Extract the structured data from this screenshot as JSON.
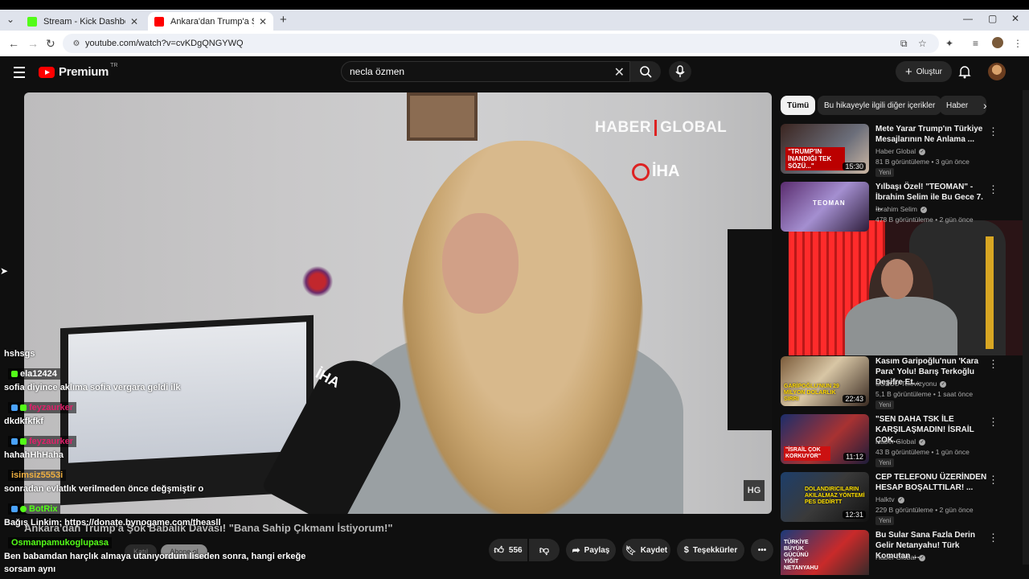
{
  "browser": {
    "tabs": [
      {
        "title": "Stream - Kick Dashboard",
        "favicon_color": "#53fc18"
      },
      {
        "title": "Ankara'dan Trump'a Şok Babal",
        "favicon_color": "#ff0000"
      }
    ],
    "url": "youtube.com/watch?v=cvKDgQNGYWQ"
  },
  "header": {
    "logo": "Premium",
    "logo_region": "TR",
    "search_value": "necla özmen",
    "create_label": "Oluştur"
  },
  "video": {
    "watermark_left": "HABER",
    "watermark_right": "GLOBAL",
    "agency": "İHA",
    "mic_label": "İHA",
    "corner_badge": "HG",
    "title": "Ankara'dan Trump'a Şok Babalık Davası! \"Bana Sahip Çıkmanı İstiyorum!\""
  },
  "chat": [
    {
      "user": "",
      "message": "hshsgs"
    },
    {
      "user": "ela12424",
      "user_color": "#ffffff",
      "message": "sofia diyince aklıma sofia vergara geldi ilk"
    },
    {
      "user": "feyzaurker",
      "user_color": "#e0206a",
      "message": "dkdkfkfkf"
    },
    {
      "user": "feyzaurker",
      "user_color": "#e0206a",
      "message": "hahahHhHaha"
    },
    {
      "user": "isimsiz5553i",
      "user_color": "#f0b040",
      "message": "sonradan evlatlık verilmeden önce değşmiştir o"
    },
    {
      "user": "BotRix",
      "user_color": "#53fc18",
      "message": "Bağış Linkim: https://donate.bynogame.com/theasll"
    },
    {
      "user": "Osmanpamukoglupasa",
      "user_color": "#53fc18",
      "message": "Ben babamdan harçlık almaya utanıyordum liseden sonra, hangi erkeğe"
    },
    {
      "user": "",
      "message": "sorsam aynı"
    }
  ],
  "ghost_buttons": {
    "join": "Katıl",
    "subscribe": "Abone ol"
  },
  "actions": {
    "likes": "556",
    "share": "Paylaş",
    "save": "Kaydet",
    "thanks": "Teşekkürler"
  },
  "chips": [
    "Tümü",
    "Bu hikayeyle ilgili diğer içerikler",
    "Haber"
  ],
  "recommendations": [
    {
      "title": "Mete Yarar Trump'ın Türkiye Mesajlarının Ne Anlama ...",
      "channel": "Haber Global",
      "meta": "81 B görüntüleme • 3 gün önce",
      "badge": "Yeni",
      "duration": "15:30",
      "thumb_text": "\"TRUMP'IN İNANDIĞI TEK SÖZÜ...\""
    },
    {
      "title": "Yılbaşı Özel! \"TEOMAN\" - İbrahim Selim ile Bu Gece 7. ...",
      "channel": "İbrahim Selim",
      "meta": "478 B görüntüleme • 2 gün önce",
      "badge": "",
      "duration": "",
      "thumb_text": "TEOMAN"
    },
    {
      "title": "Kasım Garipoğlu'nun 'Kara Para' Yolu! Barış Terkoğlu Deşifre Et...",
      "channel": "SÖZCÜ Televizyonu",
      "meta": "5,1 B görüntüleme • 1 saat önce",
      "badge": "Yeni",
      "duration": "22:43",
      "thumb_text": "GARİPOĞLU'NUN 29 MİLYON DOLARLIK SIRRI"
    },
    {
      "title": "\"SEN DAHA TSK İLE KARŞILAŞMADIN! İSRAİL ÇOK...",
      "channel": "Haber Global",
      "meta": "43 B görüntüleme • 1 gün önce",
      "badge": "Yeni",
      "duration": "11:12",
      "thumb_text": "\"İSRAİL ÇOK KORKUYOR\""
    },
    {
      "title": "CEP TELEFONU ÜZERİNDEN HESAP BOŞALTTILAR! ...",
      "channel": "Halktv",
      "meta": "229 B görüntüleme • 2 gün önce",
      "badge": "Yeni",
      "duration": "12:31",
      "thumb_text": "DOLANDIRICILARIN AKILALMAZ YÖNTEMİ PES DEDİRTT"
    },
    {
      "title": "Bu Sular Sana Fazla Derin Gelir Netanyahu! Türk Komutan ...",
      "channel": "Haber Global",
      "meta": "",
      "badge": "",
      "duration": "",
      "thumb_text": "TÜRKİYE BÜYÜK GÜCÜNÜ YİĞİT NETANYAHU"
    }
  ],
  "colors": {
    "accent": "#ff0000",
    "kick_green": "#53fc18",
    "background": "#0f0f0f"
  }
}
